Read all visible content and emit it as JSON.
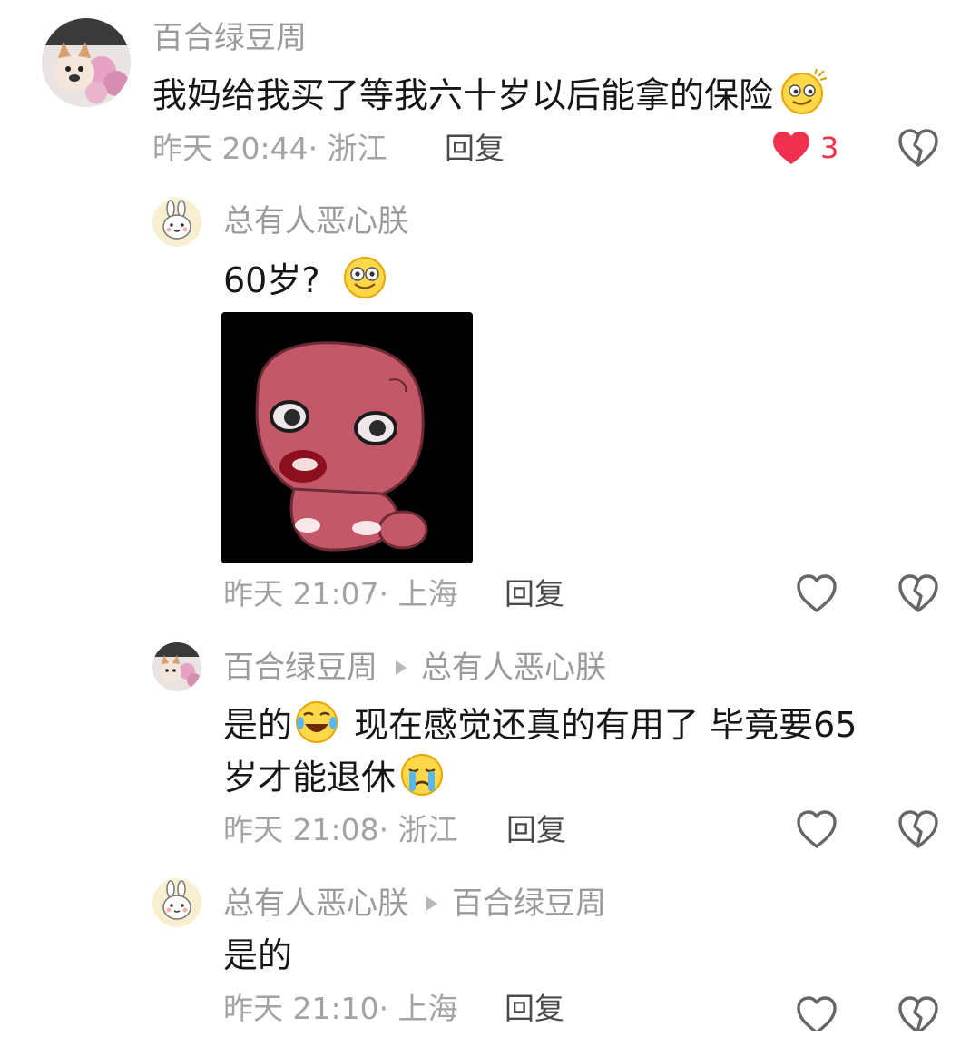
{
  "comments": [
    {
      "username": "百合绿豆周",
      "text": "我妈给我买了等我六十岁以后能拿的保险",
      "time": "昨天 20:44",
      "location": "浙江",
      "reply_label": "回复",
      "like_count": "3",
      "liked": true
    },
    {
      "username": "总有人恶心朕",
      "text": "60岁?",
      "time": "昨天 21:07",
      "location": "上海",
      "reply_label": "回复",
      "has_sticker": true
    },
    {
      "username": "百合绿豆周",
      "reply_to": "总有人恶心朕",
      "text_line1a": "是的",
      "text_line1b": "现在感觉还真的有用了 毕竟要65",
      "text_line2": "岁才能退休",
      "time": "昨天 21:08",
      "location": "浙江",
      "reply_label": "回复"
    },
    {
      "username": "总有人恶心朕",
      "reply_to": "百合绿豆周",
      "text": "是的",
      "time": "昨天 21:10",
      "location": "上海",
      "reply_label": "回复"
    }
  ],
  "colors": {
    "like_active": "#f0304f",
    "username": "#9a9a9a",
    "meta": "#a3a3a3",
    "text": "#161616"
  },
  "icons": [
    "heart-icon",
    "heart-outline-icon",
    "broken-heart-icon",
    "emoji-icon",
    "play-triangle-icon"
  ]
}
